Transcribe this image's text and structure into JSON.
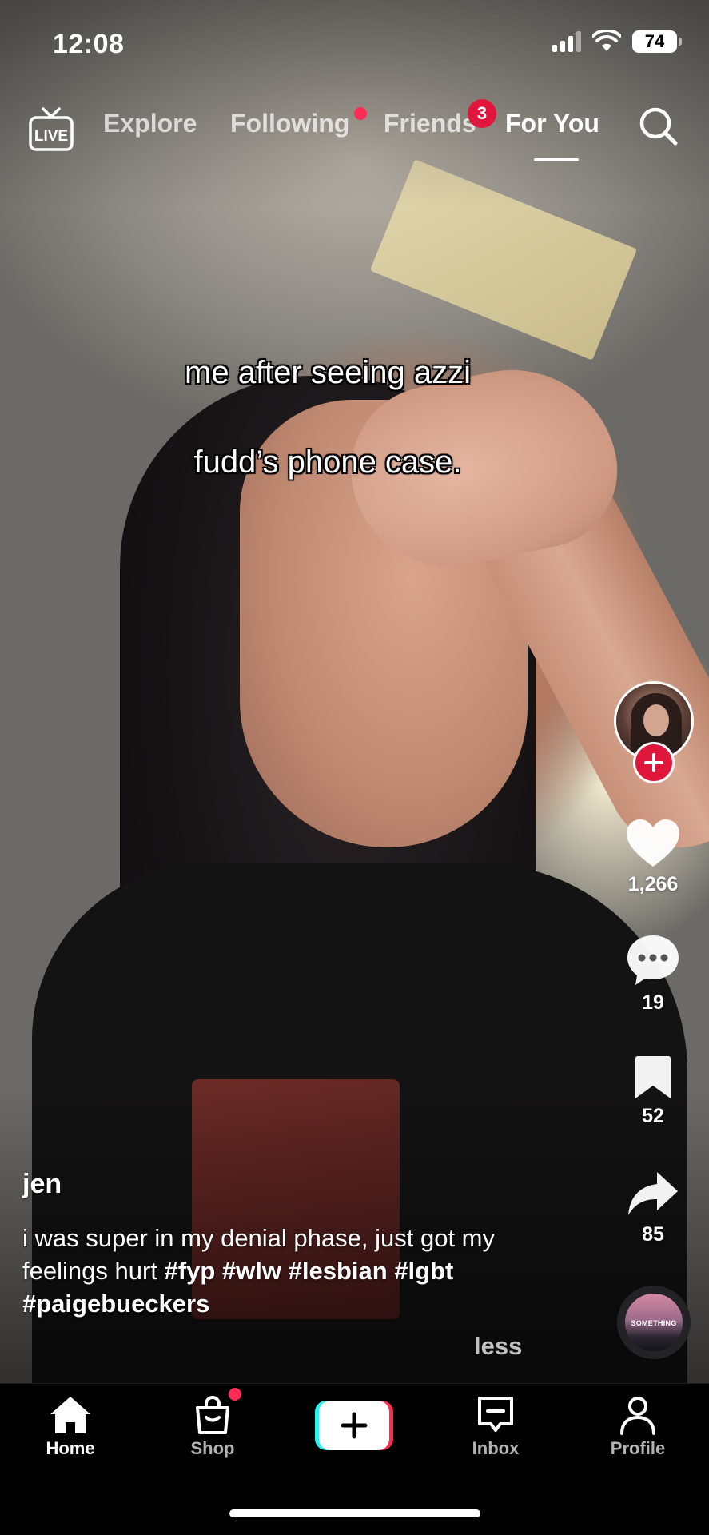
{
  "status_bar": {
    "time": "12:08",
    "battery": "74"
  },
  "top_nav": {
    "live_label": "LIVE",
    "tabs": [
      {
        "label": "Explore"
      },
      {
        "label": "Following"
      },
      {
        "label": "Friends"
      },
      {
        "label": "For You"
      }
    ],
    "active_tab": "For You",
    "friends_badge": "3"
  },
  "video": {
    "caption_line1": "me after seeing azzi",
    "caption_line2": "fudd’s phone case."
  },
  "actions": {
    "likes": "1,266",
    "comments": "19",
    "bookmarks": "52",
    "shares": "85",
    "music_disc_label": "SOMETHING"
  },
  "post": {
    "username": "jen",
    "description_text": "i was super in my denial phase, just got my feelings hurt",
    "hashtags": [
      "#fyp",
      "#wlw",
      "#lesbian",
      "#lgbt",
      "#paigebueckers"
    ],
    "less_label": "less"
  },
  "tab_bar": {
    "items": [
      {
        "label": "Home"
      },
      {
        "label": "Shop"
      },
      {
        "label": "Inbox"
      },
      {
        "label": "Profile"
      }
    ],
    "active": "Home"
  },
  "colors": {
    "accent_red": "#fe2c55",
    "badge_red": "#e1163c",
    "create_cyan": "#25f4ee"
  },
  "icons": [
    "live-icon",
    "search-icon",
    "plus-icon",
    "heart-icon",
    "comment-icon",
    "bookmark-icon",
    "share-icon",
    "home-icon",
    "shop-bag-icon",
    "inbox-icon",
    "profile-icon"
  ]
}
